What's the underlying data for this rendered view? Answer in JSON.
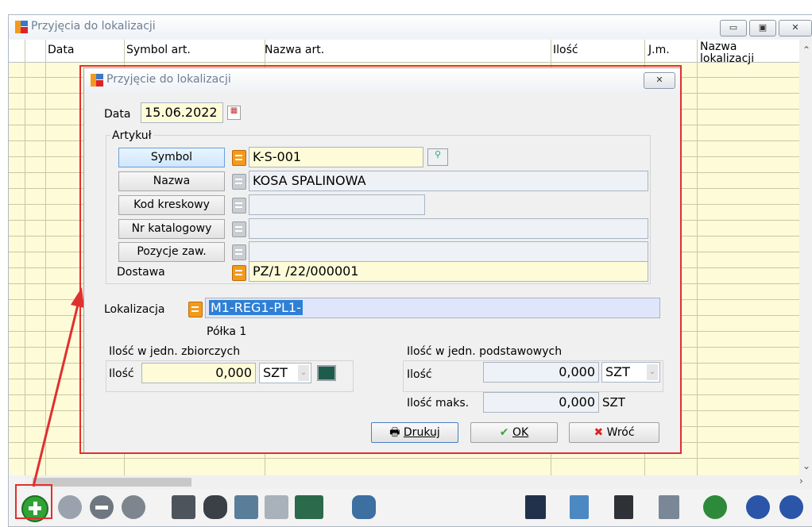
{
  "outer_window": {
    "title": "Przyjęcia do lokalizacji",
    "columns": [
      "Data",
      "Symbol art.",
      "Nazwa art.",
      "Ilość",
      "J.m.",
      "Nazwa lokalizacji"
    ]
  },
  "dialog": {
    "title": "Przyjęcie do lokalizacji",
    "date_label": "Data",
    "date_value": "15.06.2022",
    "article_group_label": "Artykuł",
    "symbol_button": "Symbol",
    "symbol_value": "K-S-001",
    "name_button": "Nazwa",
    "name_value": "KOSA SPALINOWA",
    "barcode_button": "Kod kreskowy",
    "barcode_value": "",
    "catalog_button": "Nr katalogowy",
    "catalog_value": "",
    "positions_button": "Pozycje zaw.",
    "positions_value": "",
    "delivery_label": "Dostawa",
    "delivery_value": "PZ/1  /22/000001",
    "location_label": "Lokalizacja",
    "location_value": "M1-REG1-PL1-",
    "shelf_text": "Półka 1",
    "bulk_group_label": "Ilość w jedn. zbiorczych",
    "bulk_qty_label": "Ilość",
    "bulk_qty_value": "0,000",
    "bulk_unit": "SZT",
    "base_group_label": "Ilość w jedn. podstawowych",
    "base_qty_label": "Ilość",
    "base_qty_value": "0,000",
    "base_unit": "SZT",
    "max_qty_label": "Ilość maks.",
    "max_qty_value": "0,000",
    "max_unit": "SZT",
    "print_button": "Drukuj",
    "ok_button": "OK",
    "back_button": "Wróć"
  },
  "colors": {
    "highlight": "#e03030",
    "grid_bg": "#fdfbd8",
    "selection": "#2f7fd6"
  }
}
